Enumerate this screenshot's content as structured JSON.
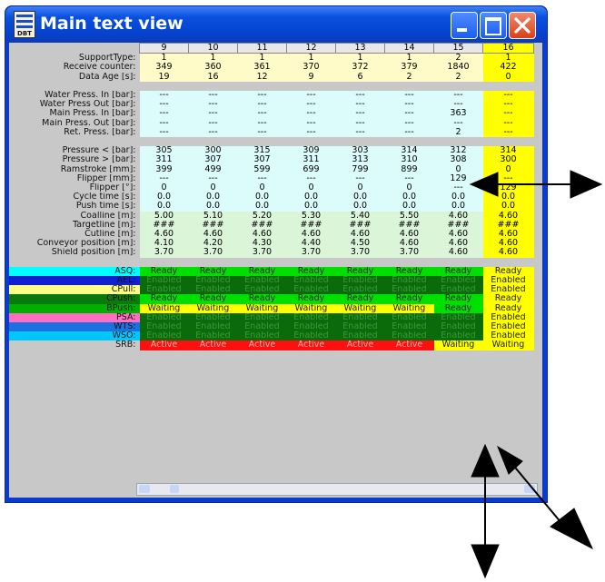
{
  "window": {
    "title": "Main text view",
    "app_icon_label": "DBT"
  },
  "columns": [
    "9",
    "10",
    "11",
    "12",
    "13",
    "14",
    "15",
    "16"
  ],
  "group1": [
    {
      "label": "SupportType:",
      "values": [
        "1",
        "1",
        "1",
        "1",
        "1",
        "1",
        "2",
        "1"
      ]
    },
    {
      "label": "Receive counter:",
      "values": [
        "349",
        "360",
        "361",
        "370",
        "372",
        "379",
        "1840",
        "422"
      ]
    },
    {
      "label": "Data Age [s]:",
      "values": [
        "19",
        "16",
        "12",
        "9",
        "6",
        "2",
        "2",
        "0"
      ]
    }
  ],
  "group2": [
    {
      "label": "Water Press. In [bar]:",
      "values": [
        "---",
        "---",
        "---",
        "---",
        "---",
        "---",
        "---",
        "---"
      ]
    },
    {
      "label": "Water Press Out [bar]:",
      "values": [
        "---",
        "---",
        "---",
        "---",
        "---",
        "---",
        "---",
        "---"
      ]
    },
    {
      "label": "Main Press. In [bar]:",
      "values": [
        "---",
        "---",
        "---",
        "---",
        "---",
        "---",
        "363",
        "---"
      ]
    },
    {
      "label": "Main Press. Out [bar]:",
      "values": [
        "---",
        "---",
        "---",
        "---",
        "---",
        "---",
        "---",
        "---"
      ]
    },
    {
      "label": "Ret. Press. [bar]:",
      "values": [
        "---",
        "---",
        "---",
        "---",
        "---",
        "---",
        "2",
        "---"
      ]
    }
  ],
  "group3": [
    {
      "label": "Pressure < [bar]:",
      "values": [
        "305",
        "300",
        "315",
        "309",
        "303",
        "314",
        "312",
        "314"
      ]
    },
    {
      "label": "Pressure > [bar]:",
      "values": [
        "311",
        "307",
        "307",
        "311",
        "313",
        "310",
        "308",
        "300"
      ]
    },
    {
      "label": "Ramstroke [mm]:",
      "values": [
        "399",
        "499",
        "599",
        "699",
        "799",
        "899",
        "0",
        "0"
      ]
    },
    {
      "label": "Flipper [mm]:",
      "values": [
        "---",
        "---",
        "---",
        "---",
        "---",
        "---",
        "129",
        "---"
      ]
    },
    {
      "label": "Flipper [°]:",
      "values": [
        "0",
        "0",
        "0",
        "0",
        "0",
        "0",
        "---",
        "129"
      ]
    },
    {
      "label": "Cycle time [s]:",
      "values": [
        "0.0",
        "0.0",
        "0.0",
        "0.0",
        "0.0",
        "0.0",
        "0.0",
        "0.0"
      ]
    },
    {
      "label": "Push time [s]:",
      "values": [
        "0.0",
        "0.0",
        "0.0",
        "0.0",
        "0.0",
        "0.0",
        "0.0",
        "0.0"
      ]
    }
  ],
  "group4": [
    {
      "label": "Coalline [m]:",
      "values": [
        "5.00",
        "5.10",
        "5.20",
        "5.30",
        "5.40",
        "5.50",
        "4.60",
        "4.60"
      ]
    },
    {
      "label": "Targetline [m]:",
      "values": [
        "###",
        "###",
        "###",
        "###",
        "###",
        "###",
        "###",
        "###"
      ]
    },
    {
      "label": "Cutline [m]:",
      "values": [
        "4.60",
        "4.60",
        "4.60",
        "4.60",
        "4.60",
        "4.60",
        "4.60",
        "4.60"
      ]
    },
    {
      "label": "Conveyor position [m]:",
      "values": [
        "4.10",
        "4.20",
        "4.30",
        "4.40",
        "4.50",
        "4.60",
        "4.60",
        "4.60"
      ]
    },
    {
      "label": "Shield position [m]:",
      "values": [
        "3.70",
        "3.70",
        "3.70",
        "3.70",
        "3.70",
        "3.70",
        "4.60",
        "4.60"
      ]
    }
  ],
  "status": [
    {
      "label": "ASQ:",
      "label_bg": "#00ffff",
      "values": [
        "Ready",
        "Ready",
        "Ready",
        "Ready",
        "Ready",
        "Ready",
        "Ready",
        "Ready"
      ],
      "colors": [
        "#00e000",
        "#00e000",
        "#00e000",
        "#00e000",
        "#00e000",
        "#00e000",
        "#00e000",
        "#ffff00"
      ]
    },
    {
      "label": "AEL:",
      "label_bg": "#1020d0",
      "values": [
        "Enabled",
        "Enabled",
        "Enabled",
        "Enabled",
        "Enabled",
        "Enabled",
        "Enabled",
        "Enabled"
      ],
      "colors": [
        "#0b6b0b",
        "#0b6b0b",
        "#0b6b0b",
        "#0b6b0b",
        "#0b6b0b",
        "#0b6b0b",
        "#0b6b0b",
        "#ffff00"
      ]
    },
    {
      "label": "CPull:",
      "label_bg": "#ffff88",
      "values": [
        "Enabled",
        "Enabled",
        "Enabled",
        "Enabled",
        "Enabled",
        "Enabled",
        "Enabled",
        "Enabled"
      ],
      "colors": [
        "#0b6b0b",
        "#0b6b0b",
        "#0b6b0b",
        "#0b6b0b",
        "#0b6b0b",
        "#0b6b0b",
        "#0b6b0b",
        "#ffff00"
      ]
    },
    {
      "label": "CPush:",
      "label_bg": "#0b7a0b",
      "values": [
        "Ready",
        "Ready",
        "Ready",
        "Ready",
        "Ready",
        "Ready",
        "Ready",
        "Ready"
      ],
      "colors": [
        "#00e000",
        "#00e000",
        "#00e000",
        "#00e000",
        "#00e000",
        "#00e000",
        "#00e000",
        "#ffff00"
      ]
    },
    {
      "label": "BPush:",
      "label_bg": "#00b000",
      "values": [
        "Waiting",
        "Waiting",
        "Waiting",
        "Waiting",
        "Waiting",
        "Waiting",
        "Ready",
        "Ready"
      ],
      "colors": [
        "#ffff00",
        "#ffff00",
        "#ffff00",
        "#ffff00",
        "#ffff00",
        "#ffff00",
        "#00e000",
        "#ffff00"
      ]
    },
    {
      "label": "PSA:",
      "label_bg": "#ff6ec0",
      "values": [
        "Enabled",
        "Enabled",
        "Enabled",
        "Enabled",
        "Enabled",
        "Enabled",
        "Enabled",
        "Enabled"
      ],
      "colors": [
        "#0b6b0b",
        "#0b6b0b",
        "#0b6b0b",
        "#0b6b0b",
        "#0b6b0b",
        "#0b6b0b",
        "#0b6b0b",
        "#ffff00"
      ]
    },
    {
      "label": "WTS:",
      "label_bg": "#1d70e0",
      "values": [
        "Enabled",
        "Enabled",
        "Enabled",
        "Enabled",
        "Enabled",
        "Enabled",
        "Enabled",
        "Enabled"
      ],
      "colors": [
        "#0b6b0b",
        "#0b6b0b",
        "#0b6b0b",
        "#0b6b0b",
        "#0b6b0b",
        "#0b6b0b",
        "#0b6b0b",
        "#ffff00"
      ]
    },
    {
      "label": "WSO:",
      "label_bg": "#00c8ff",
      "values": [
        "Enabled",
        "Enabled",
        "Enabled",
        "Enabled",
        "Enabled",
        "Enabled",
        "Enabled",
        "Enabled"
      ],
      "colors": [
        "#0b6b0b",
        "#0b6b0b",
        "#0b6b0b",
        "#0b6b0b",
        "#0b6b0b",
        "#0b6b0b",
        "#0b6b0b",
        "#ffff00"
      ]
    },
    {
      "label": "SRB:",
      "label_bg": "#c8c8c8",
      "values": [
        "Active",
        "Active",
        "Active",
        "Active",
        "Active",
        "Active",
        "Waiting",
        "Waiting"
      ],
      "colors": [
        "#ff1010",
        "#ff1010",
        "#ff1010",
        "#ff1010",
        "#ff1010",
        "#ff1010",
        "#ffff00",
        "#ffff00"
      ]
    }
  ]
}
